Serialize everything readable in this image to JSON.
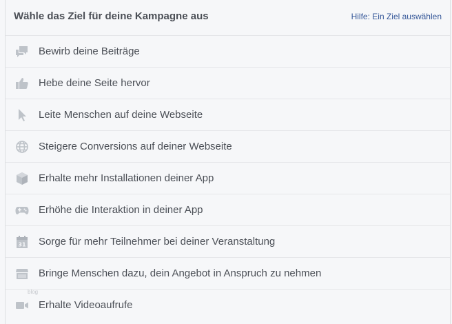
{
  "header": {
    "title": "Wähle das Ziel für deine Kampagne aus",
    "help_link": "Hilfe: Ein Ziel auswählen"
  },
  "objectives": [
    {
      "label": "Bewirb deine Beiträge",
      "icon": "speech-bubbles-icon"
    },
    {
      "label": "Hebe deine Seite hervor",
      "icon": "thumbs-up-icon"
    },
    {
      "label": "Leite Menschen auf deine Webseite",
      "icon": "cursor-arrow-icon"
    },
    {
      "label": "Steigere Conversions auf deiner Webseite",
      "icon": "globe-icon"
    },
    {
      "label": "Erhalte mehr Installationen deiner App",
      "icon": "box-icon"
    },
    {
      "label": "Erhöhe die Interaktion in deiner App",
      "icon": "gamepad-icon"
    },
    {
      "label": "Sorge für mehr Teilnehmer bei deiner Veranstaltung",
      "icon": "calendar-icon",
      "icon_text": "31"
    },
    {
      "label": "Bringe Menschen dazu, dein Angebot in Anspruch zu nehmen",
      "icon": "storefront-icon"
    },
    {
      "label": "Erhalte Videoaufrufe",
      "icon": "video-camera-icon"
    }
  ],
  "watermark": "blog",
  "colors": {
    "background": "#f6f7f9",
    "icon": "#bec3c9",
    "text": "#4b4f56",
    "link": "#365899",
    "divider": "#e5e6e9"
  }
}
